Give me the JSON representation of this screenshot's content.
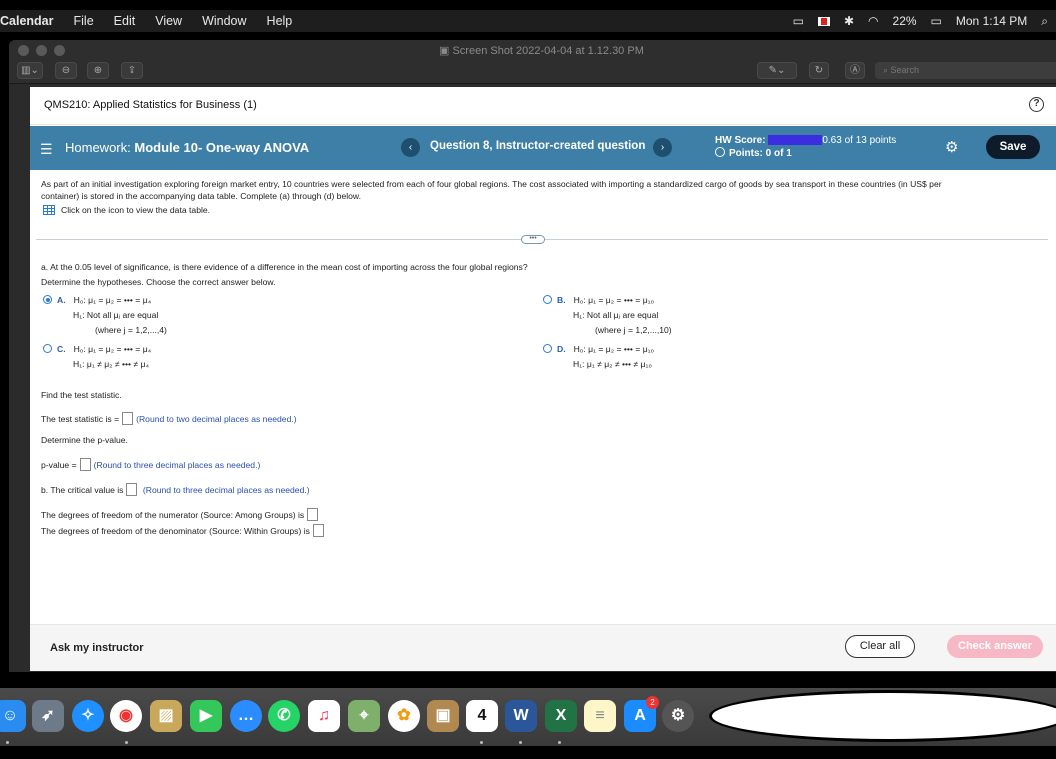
{
  "menubar": {
    "app": "Calendar",
    "items": [
      "File",
      "Edit",
      "View",
      "Window",
      "Help"
    ],
    "battery": "22%",
    "clock": "Mon 1:14 PM"
  },
  "window": {
    "title": "Screen Shot 2022-04-04 at 1.12.30 PM",
    "search_placeholder": "Search"
  },
  "course": {
    "title": "QMS210: Applied Statistics for Business (1)"
  },
  "homework": {
    "prefix": "Homework:",
    "name": "Module 10- One-way ANOVA",
    "question": "Question 8, Instructor-created question",
    "score_label": "HW Score:",
    "score_value": "0.63 of 13 points",
    "points": "Points: 0 of 1",
    "save": "Save"
  },
  "question": {
    "intro1": "As part of an initial investigation exploring foreign market entry, 10 countries were selected from each of four global regions. The cost associated with importing a standardized cargo of goods by sea transport in these countries (in US$ per",
    "intro2": "container) is stored in the accompanying data table. Complete (a) through (d) below.",
    "table_link": "Click on the icon to view the data table.",
    "part_a": "a. At the 0.05 level of significance, is there evidence of a difference in the mean cost of importing across the four global regions?",
    "determine_hyp": "Determine the hypotheses. Choose the correct answer below.",
    "options": {
      "A": {
        "key": "A.",
        "h0": "H₀: μ₁ = μ₂ = ••• = μ₄",
        "h1": "H₁: Not all μⱼ are equal",
        "note": "(where j = 1,2,...,4)"
      },
      "B": {
        "key": "B.",
        "h0": "H₀: μ₁ = μ₂ = ••• = μ₁₀",
        "h1": "H₁: Not all μⱼ are equal",
        "note": "(where j = 1,2,...,10)"
      },
      "C": {
        "key": "C.",
        "h0": "H₀: μ₁ = μ₂ = ••• = μ₄",
        "h1": "H₁: μ₁ ≠ μ₂ ≠ ••• ≠ μ₄"
      },
      "D": {
        "key": "D.",
        "h0": "H₀: μ₁ = μ₂ = ••• = μ₁₀",
        "h1": "H₁: μ₁ ≠ μ₂ ≠ ••• ≠ μ₁₀"
      }
    },
    "selected": "A",
    "find_stat": "Find the test statistic.",
    "stat_label": "The test statistic is =",
    "stat_hint": "(Round to two decimal places as needed.)",
    "det_pvalue": "Determine the p-value.",
    "pvalue_label": "p-value =",
    "pvalue_hint": "(Round to three decimal places as needed.)",
    "part_b": "b. The critical value is",
    "crit_hint": "(Round to three decimal places as needed.)",
    "df_num": "The degrees of freedom of the numerator (Source: Among Groups) is",
    "df_den": "The degrees of freedom of the denominator (Source: Within Groups) is"
  },
  "footer": {
    "ask": "Ask my instructor",
    "clear": "Clear all",
    "check": "Check answer"
  },
  "dock": {
    "calendar_day": "4",
    "appstore_badge": "2"
  },
  "colors": {
    "hw_bar": "#3d7fa6",
    "save_btn": "#0e1b2b",
    "check_btn_disabled": "#f7b8c6",
    "link_blue": "#2a4fb0"
  }
}
